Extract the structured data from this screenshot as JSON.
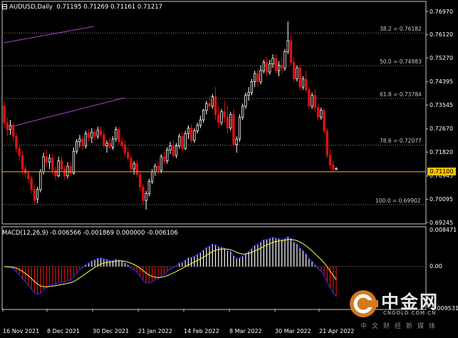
{
  "header": {
    "symbol": "AUDUSD,Daily",
    "ohlc": "0.71195 0.71269 0.71161 0.71217"
  },
  "macd_header": "MACD(12,26,9) -0.006566 -0.001869 0.000000 -0.006106",
  "price_axis": [
    "0.76970",
    "0.76120",
    "0.75270",
    "0.74395",
    "0.73545",
    "0.72670",
    "0.71820",
    "0.70945",
    "0.70095",
    "0.69245"
  ],
  "current_price": "0.71100",
  "macd_axis": [
    "0.008471",
    "0.00",
    "-0.009531"
  ],
  "time_axis": [
    "16 Nov 2021",
    "8 Dec 2021",
    "30 Dec 2021",
    "21 Jan 2022",
    "14 Feb 2022",
    "8 Mar 2022",
    "30 Mar 2022",
    "21 Apr 2022"
  ],
  "fib_levels": [
    {
      "label": "38.2 = 0.76182",
      "price": 0.76182
    },
    {
      "label": "50.0 = 0.74983",
      "price": 0.74983
    },
    {
      "label": "61.8 = 0.73784",
      "price": 0.73784
    },
    {
      "label": "78.6 = 0.72077",
      "price": 0.72077
    },
    {
      "label": "100.0 = 0.69902",
      "price": 0.69902
    }
  ],
  "watermark": {
    "name": "中金网",
    "site": "CNGOLD.COM.CN",
    "slogan": "中文财经新媒体"
  },
  "colors": {
    "background": "#000000",
    "bull_candle": "#ffffff",
    "bear_candle": "#e01010",
    "fib_line": "#8a8a8a",
    "current_price_line": "#f5c000",
    "trendline": "#b040d0",
    "macd_line": "#2030ff",
    "signal_line": "#ffff40",
    "hist_pos": "#ffffff",
    "hist_neg": "#e01010"
  },
  "chart_data": {
    "type": "candlestick",
    "price_range": [
      0.69245,
      0.7697
    ],
    "candles": [
      [
        0.735,
        0.7368,
        0.727,
        0.729
      ],
      [
        0.729,
        0.731,
        0.724,
        0.7265
      ],
      [
        0.7265,
        0.73,
        0.7245,
        0.728
      ],
      [
        0.728,
        0.729,
        0.722,
        0.724
      ],
      [
        0.724,
        0.725,
        0.718,
        0.7195
      ],
      [
        0.7195,
        0.721,
        0.715,
        0.717
      ],
      [
        0.717,
        0.7185,
        0.71,
        0.712
      ],
      [
        0.712,
        0.7135,
        0.709,
        0.7105
      ],
      [
        0.7105,
        0.7115,
        0.707,
        0.7085
      ],
      [
        0.7085,
        0.7095,
        0.703,
        0.7045
      ],
      [
        0.7045,
        0.706,
        0.6993,
        0.7005
      ],
      [
        0.701,
        0.7055,
        0.6995,
        0.7045
      ],
      [
        0.7045,
        0.712,
        0.7035,
        0.711
      ],
      [
        0.711,
        0.718,
        0.71,
        0.7165
      ],
      [
        0.7165,
        0.719,
        0.713,
        0.7145
      ],
      [
        0.7145,
        0.7175,
        0.712,
        0.716
      ],
      [
        0.716,
        0.7175,
        0.71,
        0.7115
      ],
      [
        0.7115,
        0.713,
        0.708,
        0.7095
      ],
      [
        0.7095,
        0.7165,
        0.709,
        0.715
      ],
      [
        0.715,
        0.7165,
        0.711,
        0.712
      ],
      [
        0.712,
        0.7135,
        0.708,
        0.7095
      ],
      [
        0.7095,
        0.7145,
        0.7085,
        0.713
      ],
      [
        0.713,
        0.7145,
        0.7095,
        0.7105
      ],
      [
        0.7105,
        0.72,
        0.71,
        0.7185
      ],
      [
        0.7185,
        0.723,
        0.7175,
        0.722
      ],
      [
        0.722,
        0.7245,
        0.72,
        0.723
      ],
      [
        0.723,
        0.724,
        0.719,
        0.7205
      ],
      [
        0.7205,
        0.726,
        0.7195,
        0.725
      ],
      [
        0.725,
        0.7265,
        0.722,
        0.7235
      ],
      [
        0.7235,
        0.727,
        0.7215,
        0.7255
      ],
      [
        0.7255,
        0.7265,
        0.7225,
        0.724
      ],
      [
        0.724,
        0.7275,
        0.723,
        0.7262
      ],
      [
        0.7262,
        0.7276,
        0.7235,
        0.7245
      ],
      [
        0.7245,
        0.726,
        0.7195,
        0.7205
      ],
      [
        0.7205,
        0.7225,
        0.718,
        0.7215
      ],
      [
        0.7215,
        0.7235,
        0.7195,
        0.72
      ],
      [
        0.72,
        0.724,
        0.719,
        0.723
      ],
      [
        0.723,
        0.7275,
        0.722,
        0.7265
      ],
      [
        0.7265,
        0.7275,
        0.721,
        0.722
      ],
      [
        0.722,
        0.7235,
        0.7195,
        0.7205
      ],
      [
        0.7205,
        0.7225,
        0.717,
        0.718
      ],
      [
        0.718,
        0.72,
        0.715,
        0.716
      ],
      [
        0.716,
        0.717,
        0.711,
        0.712
      ],
      [
        0.712,
        0.715,
        0.71,
        0.714
      ],
      [
        0.714,
        0.7155,
        0.709,
        0.71
      ],
      [
        0.71,
        0.7115,
        0.704,
        0.7055
      ],
      [
        0.7055,
        0.7065,
        0.699,
        0.7005
      ],
      [
        0.7005,
        0.704,
        0.6972,
        0.703
      ],
      [
        0.703,
        0.7085,
        0.702,
        0.7075
      ],
      [
        0.7075,
        0.712,
        0.7065,
        0.711
      ],
      [
        0.711,
        0.714,
        0.7095,
        0.713
      ],
      [
        0.713,
        0.715,
        0.71,
        0.7115
      ],
      [
        0.7115,
        0.7175,
        0.7105,
        0.7165
      ],
      [
        0.7165,
        0.7185,
        0.714,
        0.715
      ],
      [
        0.715,
        0.72,
        0.714,
        0.719
      ],
      [
        0.719,
        0.722,
        0.7175,
        0.7205
      ],
      [
        0.7205,
        0.7225,
        0.716,
        0.717
      ],
      [
        0.717,
        0.7215,
        0.716,
        0.7205
      ],
      [
        0.7205,
        0.725,
        0.7195,
        0.724
      ],
      [
        0.724,
        0.7255,
        0.7185,
        0.7195
      ],
      [
        0.7195,
        0.726,
        0.719,
        0.725
      ],
      [
        0.725,
        0.728,
        0.723,
        0.727
      ],
      [
        0.727,
        0.7285,
        0.7215,
        0.7225
      ],
      [
        0.7225,
        0.727,
        0.7215,
        0.726
      ],
      [
        0.726,
        0.729,
        0.725,
        0.728
      ],
      [
        0.728,
        0.7315,
        0.727,
        0.73
      ],
      [
        0.73,
        0.734,
        0.729,
        0.7335
      ],
      [
        0.7335,
        0.737,
        0.732,
        0.736
      ],
      [
        0.736,
        0.739,
        0.734,
        0.735
      ],
      [
        0.735,
        0.7395,
        0.734,
        0.7385
      ],
      [
        0.7385,
        0.742,
        0.73,
        0.732
      ],
      [
        0.732,
        0.735,
        0.727,
        0.729
      ],
      [
        0.729,
        0.734,
        0.728,
        0.733
      ],
      [
        0.733,
        0.737,
        0.729,
        0.731
      ],
      [
        0.731,
        0.735,
        0.725,
        0.727
      ],
      [
        0.727,
        0.733,
        0.726,
        0.732
      ],
      [
        0.732,
        0.734,
        0.72,
        0.721
      ],
      [
        0.721,
        0.724,
        0.718,
        0.723
      ],
      [
        0.723,
        0.732,
        0.722,
        0.731
      ],
      [
        0.731,
        0.736,
        0.73,
        0.735
      ],
      [
        0.735,
        0.74,
        0.734,
        0.739
      ],
      [
        0.739,
        0.742,
        0.737,
        0.74
      ],
      [
        0.74,
        0.745,
        0.739,
        0.744
      ],
      [
        0.744,
        0.748,
        0.742,
        0.747
      ],
      [
        0.747,
        0.749,
        0.742,
        0.744
      ],
      [
        0.744,
        0.75,
        0.743,
        0.748
      ],
      [
        0.748,
        0.752,
        0.747,
        0.751
      ],
      [
        0.751,
        0.753,
        0.746,
        0.7475
      ],
      [
        0.7475,
        0.752,
        0.7465,
        0.7505
      ],
      [
        0.7505,
        0.754,
        0.749,
        0.7525
      ],
      [
        0.7525,
        0.754,
        0.747,
        0.748
      ],
      [
        0.748,
        0.7515,
        0.746,
        0.75
      ],
      [
        0.75,
        0.753,
        0.747,
        0.749
      ],
      [
        0.749,
        0.756,
        0.748,
        0.755
      ],
      [
        0.755,
        0.766,
        0.754,
        0.759
      ],
      [
        0.759,
        0.761,
        0.75,
        0.751
      ],
      [
        0.751,
        0.753,
        0.744,
        0.745
      ],
      [
        0.745,
        0.75,
        0.744,
        0.749
      ],
      [
        0.749,
        0.75,
        0.741,
        0.742
      ],
      [
        0.742,
        0.746,
        0.741,
        0.745
      ],
      [
        0.745,
        0.748,
        0.74,
        0.741
      ],
      [
        0.741,
        0.742,
        0.734,
        0.735
      ],
      [
        0.735,
        0.74,
        0.734,
        0.739
      ],
      [
        0.739,
        0.741,
        0.733,
        0.7345
      ],
      [
        0.7345,
        0.736,
        0.73,
        0.731
      ],
      [
        0.731,
        0.7345,
        0.73,
        0.7335
      ],
      [
        0.7335,
        0.734,
        0.725,
        0.726
      ],
      [
        0.726,
        0.727,
        0.716,
        0.717
      ],
      [
        0.717,
        0.719,
        0.712,
        0.7135
      ],
      [
        0.7135,
        0.715,
        0.711,
        0.712
      ],
      [
        0.7119,
        0.7127,
        0.7116,
        0.7122
      ]
    ],
    "macd_range": [
      -0.009531,
      0.008471
    ],
    "current_price": 0.711,
    "fib_levels": [
      0.76182,
      0.74983,
      0.73784,
      0.72077,
      0.69902
    ]
  }
}
